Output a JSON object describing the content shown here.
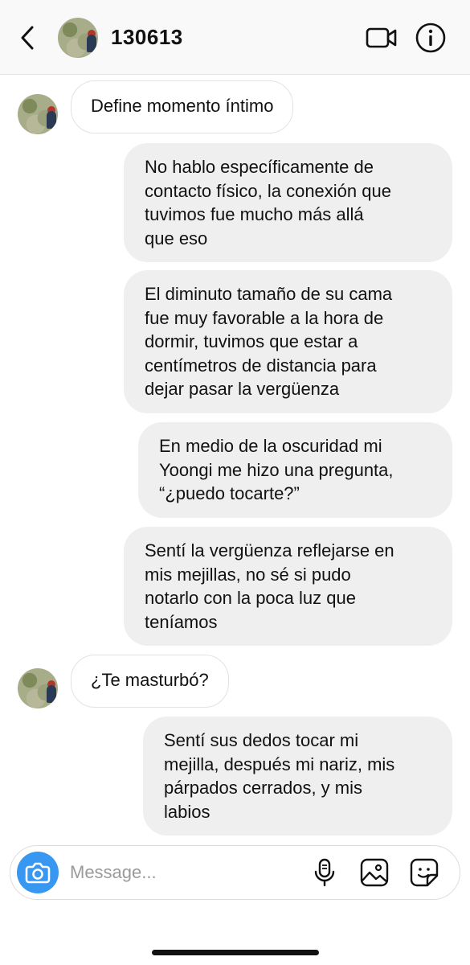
{
  "header": {
    "username": "130613"
  },
  "icons": {
    "back": "chevron-left-icon",
    "video": "video-camera-icon",
    "info": "info-icon",
    "camera": "camera-icon",
    "mic": "microphone-icon",
    "gallery": "image-icon",
    "sticker": "sticker-icon"
  },
  "messages": [
    {
      "from": "them",
      "text": "Define momento íntimo"
    },
    {
      "from": "me",
      "lines": [
        "No hablo específicamente de",
        "contacto físico, la conexión que",
        "tuvimos fue mucho más allá",
        "que eso"
      ]
    },
    {
      "from": "me",
      "lines": [
        "El diminuto tamaño de su cama",
        "fue muy favorable a la hora de",
        "dormir, tuvimos que estar a",
        "centímetros de distancia para",
        "dejar pasar la vergüenza"
      ]
    },
    {
      "from": "me",
      "lines": [
        "En medio de la oscuridad mi",
        "Yoongi me hizo una pregunta,",
        "“¿puedo tocarte?”"
      ]
    },
    {
      "from": "me",
      "lines": [
        "Sentí la vergüenza reflejarse en",
        "mis mejillas, no sé si pudo",
        "notarlo con la poca luz que",
        "teníamos"
      ]
    },
    {
      "from": "them",
      "text": "¿Te masturbó?"
    },
    {
      "from": "me",
      "lines": [
        "Sentí sus dedos tocar mi",
        "mejilla, después mi nariz, mis",
        "párpados cerrados, y mis",
        "labios"
      ]
    }
  ],
  "composer": {
    "placeholder": "Message..."
  },
  "colors": {
    "accent": "#3897f0",
    "outgoing_bubble": "#efefef",
    "incoming_border": "#e2e2e2"
  }
}
